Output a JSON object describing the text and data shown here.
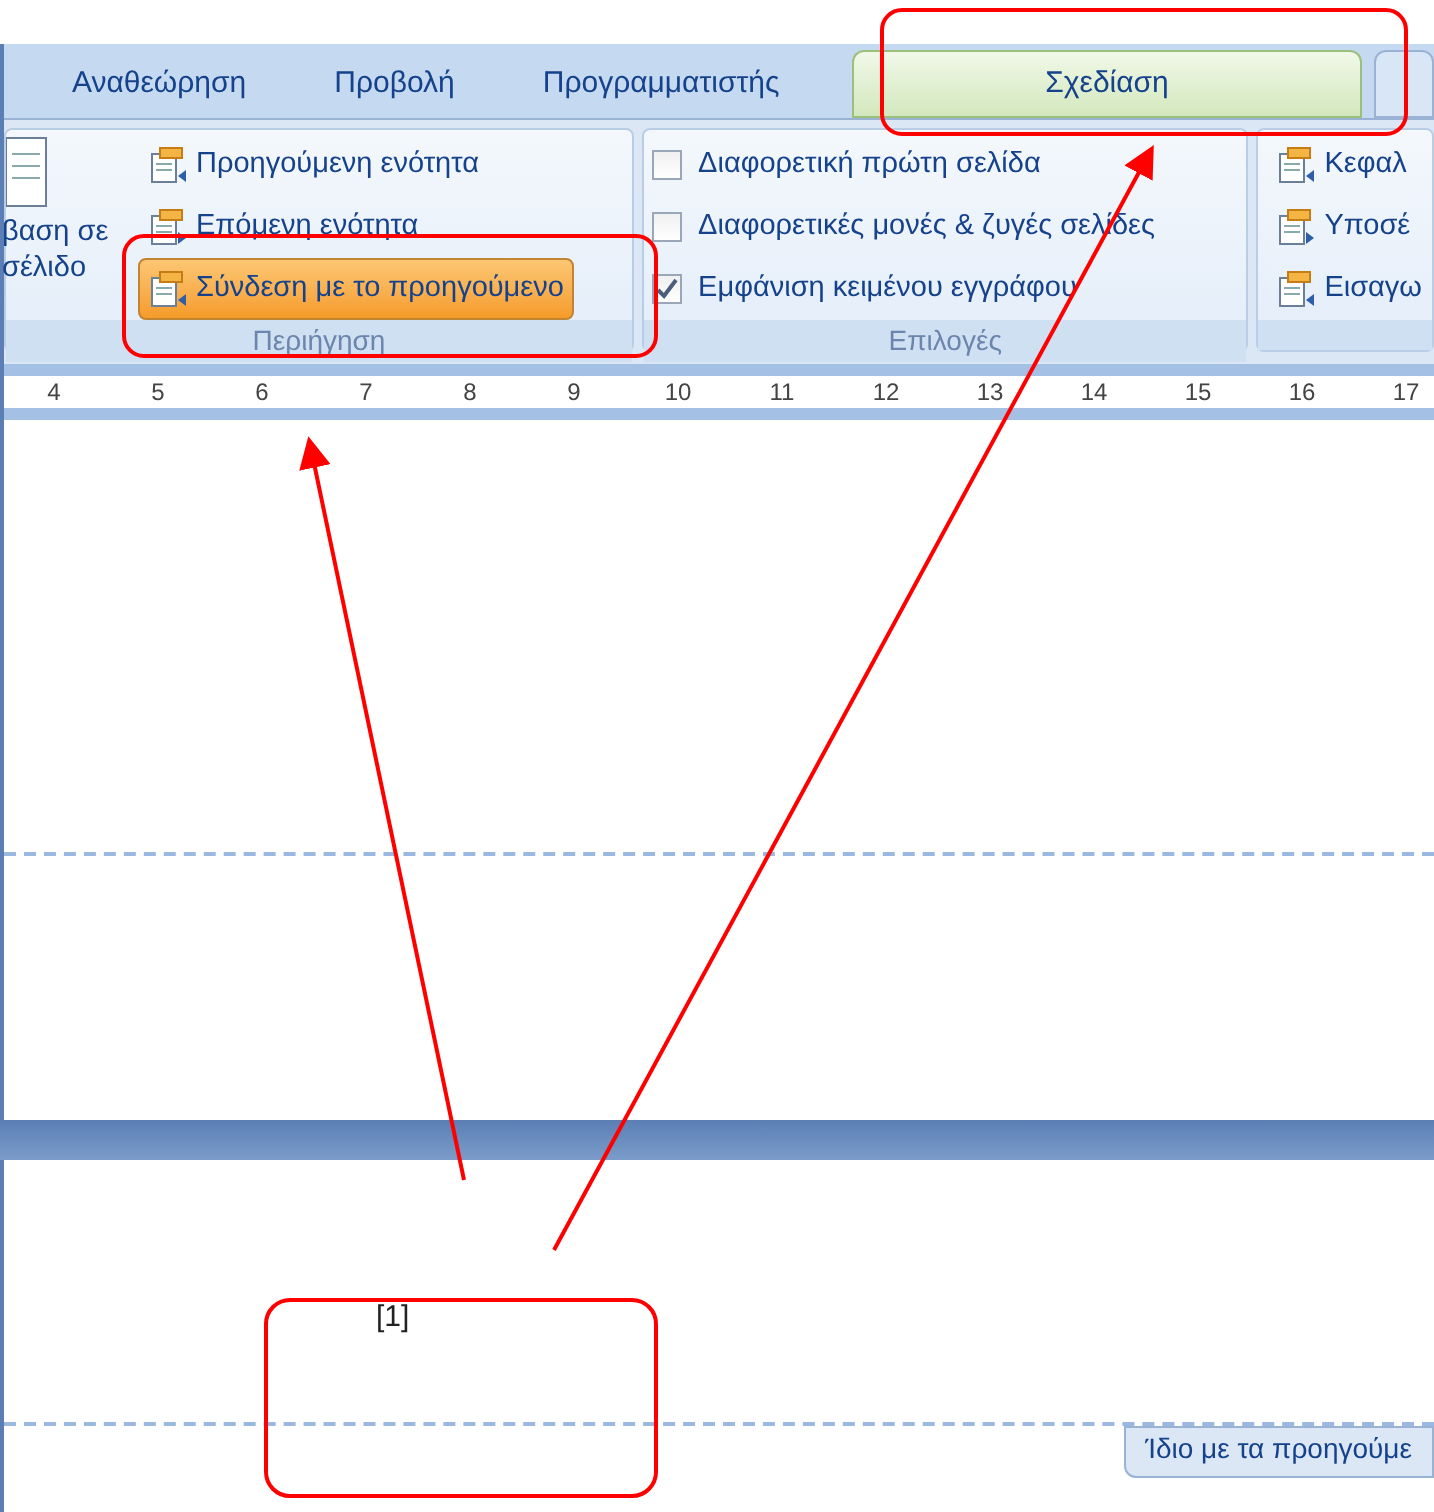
{
  "tabs": [
    {
      "label": "Αναθεώρηση",
      "selected": false
    },
    {
      "label": "Προβολή",
      "selected": false
    },
    {
      "label": "Προγραμματιστής",
      "selected": false
    },
    {
      "label": "Σχεδίαση",
      "selected": true
    }
  ],
  "ribbon": {
    "groups": [
      {
        "label": "Περιήγηση",
        "large_button": [
          "βαση σε",
          "σέλιδο"
        ],
        "items": [
          {
            "kind": "button",
            "label": "Προηγούμενη ενότητα",
            "active": false
          },
          {
            "kind": "button",
            "label": "Επόμενη ενότητα",
            "active": false
          },
          {
            "kind": "button",
            "label": "Σύνδεση με το προηγούμενο",
            "active": true
          }
        ]
      },
      {
        "label": "Επιλογές",
        "items": [
          {
            "kind": "checkbox",
            "label": "Διαφορετική πρώτη σελίδα",
            "checked": false
          },
          {
            "kind": "checkbox",
            "label": "Διαφορετικές μονές & ζυγές σελίδες",
            "checked": false
          },
          {
            "kind": "checkbox",
            "label": "Εμφάνιση κειμένου εγγράφου",
            "checked": true
          }
        ]
      },
      {
        "items": [
          {
            "kind": "button",
            "label": "Κεφαλ",
            "active": false
          },
          {
            "kind": "button",
            "label": "Υποσέ",
            "active": false
          },
          {
            "kind": "button",
            "label": "Εισαγω",
            "active": false
          }
        ]
      }
    ]
  },
  "ruler": {
    "marks": [
      "4",
      "5",
      "6",
      "7",
      "8",
      "9",
      "10",
      "11",
      "12",
      "13",
      "14",
      "15",
      "16",
      "17"
    ]
  },
  "document": {
    "footer_field": "[1]",
    "footer_tag": "Ίδιο με τα προηγούμε"
  }
}
